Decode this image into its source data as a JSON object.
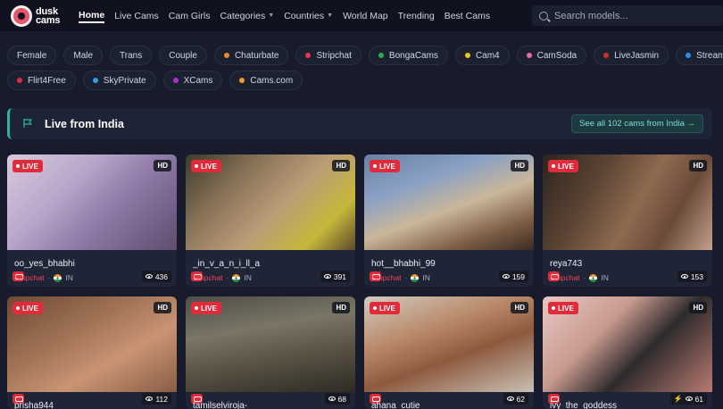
{
  "header": {
    "logo_line1": "dusk",
    "logo_line2": "cams",
    "nav": [
      {
        "label": "Home",
        "active": true
      },
      {
        "label": "Live Cams"
      },
      {
        "label": "Cam Girls"
      },
      {
        "label": "Categories",
        "dropdown": true
      },
      {
        "label": "Countries",
        "dropdown": true
      },
      {
        "label": "World Map"
      },
      {
        "label": "Trending"
      },
      {
        "label": "Best Cams"
      }
    ],
    "search_placeholder": "Search models..."
  },
  "filters": {
    "row1": [
      {
        "label": "Female"
      },
      {
        "label": "Male"
      },
      {
        "label": "Trans"
      },
      {
        "label": "Couple"
      },
      {
        "label": "Chaturbate",
        "color": "#f0892a"
      },
      {
        "label": "Stripchat",
        "color": "#e8354a"
      },
      {
        "label": "BongaCams",
        "color": "#22b04a"
      },
      {
        "label": "Cam4",
        "color": "#f2c418"
      },
      {
        "label": "CamSoda",
        "color": "#e86aa8"
      },
      {
        "label": "LiveJasmin",
        "color": "#d42a2a"
      },
      {
        "label": "Streamate",
        "color": "#2a8ee8"
      }
    ],
    "row2": [
      {
        "label": "Flirt4Free",
        "color": "#e02b3a"
      },
      {
        "label": "SkyPrivate",
        "color": "#2a9ee8"
      },
      {
        "label": "XCams",
        "color": "#b02ad6"
      },
      {
        "label": "Cams.com",
        "color": "#f29a2a"
      }
    ]
  },
  "section": {
    "title": "Live from India",
    "see_all": "See all 102 cams from India →"
  },
  "cards": [
    {
      "username": "oo_yes_bhabhi",
      "platform": "Stripchat",
      "country": "IN",
      "viewers": "436",
      "live": "LIVE",
      "hd": "HD"
    },
    {
      "username": "_in_v_a_n_i_ll_a",
      "platform": "Stripchat",
      "country": "IN",
      "viewers": "391",
      "live": "LIVE",
      "hd": "HD"
    },
    {
      "username": "hot__bhabhi_99",
      "platform": "Stripchat",
      "country": "IN",
      "viewers": "159",
      "live": "LIVE",
      "hd": "HD"
    },
    {
      "username": "reya743",
      "platform": "Stripchat",
      "country": "IN",
      "viewers": "153",
      "live": "LIVE",
      "hd": "HD"
    },
    {
      "username": "prisha944",
      "platform": "",
      "country": "",
      "viewers": "112",
      "live": "LIVE",
      "hd": "HD"
    },
    {
      "username": "tamilselviroja-",
      "platform": "",
      "country": "",
      "viewers": "68",
      "live": "LIVE",
      "hd": "HD"
    },
    {
      "username": "ahana_cutie",
      "platform": "",
      "country": "",
      "viewers": "62",
      "live": "LIVE",
      "hd": "HD"
    },
    {
      "username": "ivy_the_goddess",
      "platform": "",
      "country": "",
      "viewers": "61",
      "live": "LIVE",
      "hd": "HD",
      "bolt": true
    }
  ]
}
